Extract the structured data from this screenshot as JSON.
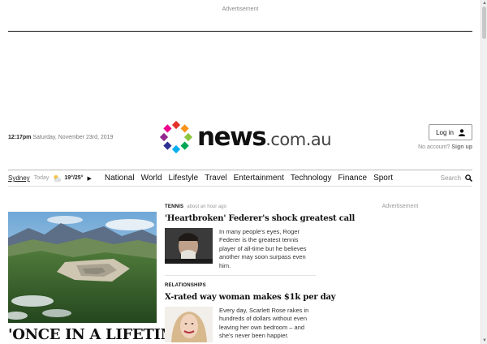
{
  "advertisement_top": "Advertisement",
  "advertisement_side": "Advertisement",
  "header": {
    "time": "12:17pm",
    "date": "Saturday, November 23rd, 2019",
    "logo_main": "news",
    "logo_domain": ".com.au",
    "login_label": "Log in",
    "no_account": "No account?",
    "sign_up": "Sign up"
  },
  "nav": {
    "city": "Sydney",
    "today": "Today",
    "temp": "19°/25°",
    "links": [
      "National",
      "World",
      "Lifestyle",
      "Travel",
      "Entertainment",
      "Technology",
      "Finance",
      "Sport"
    ],
    "search_label": "Search"
  },
  "hero": {
    "title": "'ONCE IN A LIFETIME':"
  },
  "stories": [
    {
      "kicker": "TENNIS",
      "time_ago": "about an hour ago",
      "title": "'Heartbroken' Federer's shock greatest call",
      "summary": "In many people's eyes, Roger Federer is the greatest tennis player of all-time but he believes another may soon surpass even him."
    },
    {
      "kicker": "RELATIONSHIPS",
      "time_ago": "",
      "title": "X-rated way woman makes $1k per day",
      "summary": "Every day, Scarlett Rose rakes in hundreds of dollars without even leaving her own bedroom – and she's never been happier."
    }
  ],
  "colors": {
    "logo_dots": [
      "#e4312b",
      "#f7941d",
      "#8dc63f",
      "#00a651",
      "#00aeef",
      "#2e3192",
      "#92278f",
      "#ec008c"
    ]
  },
  "icons": {
    "login": "user-icon",
    "weather": "partly-cloudy-icon",
    "nav_chevron": "chevron-right-icon",
    "search": "search-icon"
  }
}
